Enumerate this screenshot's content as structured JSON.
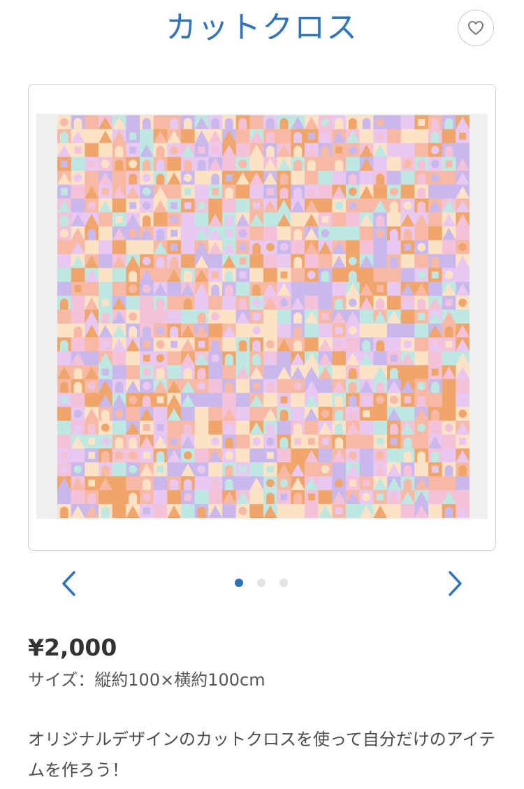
{
  "header": {
    "title": "カットクロス",
    "favorite_icon": "heart-outline-icon"
  },
  "gallery": {
    "image_alt": "カットクロス",
    "prev_icon": "chevron-left-icon",
    "next_icon": "chevron-right-icon",
    "total_images": 3,
    "current_index": 0,
    "colors": {
      "accent": "#2f73bd",
      "dot_inactive": "#e2e2e2",
      "pattern": [
        "#f7b9a4",
        "#c9b8ec",
        "#f3c2d8",
        "#fde2c6",
        "#bde7e1",
        "#f0a66a",
        "#e8c8f0"
      ]
    }
  },
  "product": {
    "price": "¥2,000",
    "size": "サイズ：縦約100×横約100cm",
    "description": "オリジナルデザインのカットクロスを使って自分だけのアイテムを作ろう！"
  }
}
